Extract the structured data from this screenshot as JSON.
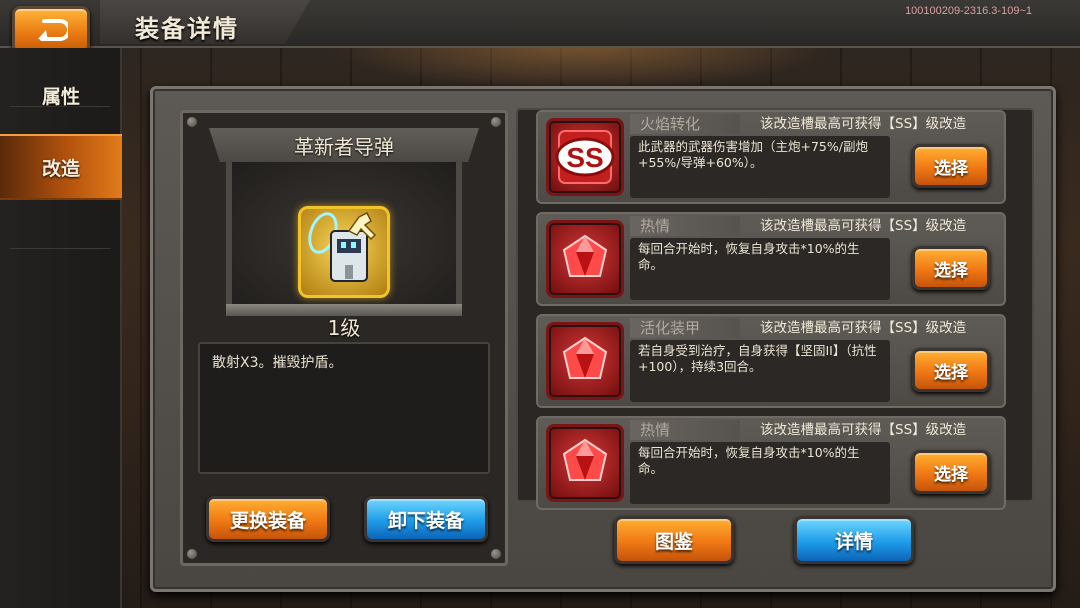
{
  "header": {
    "title": "装备详情",
    "version": "100100209-2316.3-109~1",
    "back_icon": "back-arrow-icon"
  },
  "sidebar": {
    "items": [
      {
        "label": "属性",
        "active": false
      },
      {
        "label": "改造",
        "active": true
      }
    ]
  },
  "equipment": {
    "name": "革新者导弹",
    "level": "1级",
    "icon": "missile-launcher-icon",
    "description": "散射X3。摧毁护盾。",
    "replace_button": "更换装备",
    "unequip_button": "卸下装备"
  },
  "mods": [
    {
      "name": "火焰转化",
      "cap": "该改造槽最高可获得【SS】级改造",
      "desc": "此武器的武器伤害增加（主炮+75%/副炮+55%/导弹+60%）。",
      "icon": "ss-badge-icon",
      "icon_text": "SS",
      "button": "选择"
    },
    {
      "name": "热情",
      "cap": "该改造槽最高可获得【SS】级改造",
      "desc": "每回合开始时，恢复自身攻击*10%的生命。",
      "icon": "red-gem-icon",
      "button": "选择"
    },
    {
      "name": "活化装甲",
      "cap": "该改造槽最高可获得【SS】级改造",
      "desc": "若自身受到治疗，自身获得【坚固II】（抗性+100），持续3回合。",
      "icon": "red-gem-icon",
      "button": "选择"
    },
    {
      "name": "热情",
      "cap": "该改造槽最高可获得【SS】级改造",
      "desc": "每回合开始时，恢复自身攻击*10%的生命。",
      "icon": "red-gem-icon",
      "button": "选择"
    }
  ],
  "footer": {
    "codex_button": "图鉴",
    "details_button": "详情"
  },
  "colors": {
    "accent_orange": "#f07814",
    "accent_blue": "#1e9ce8",
    "gem_red": "#d43838",
    "frame": "#5d5955"
  }
}
